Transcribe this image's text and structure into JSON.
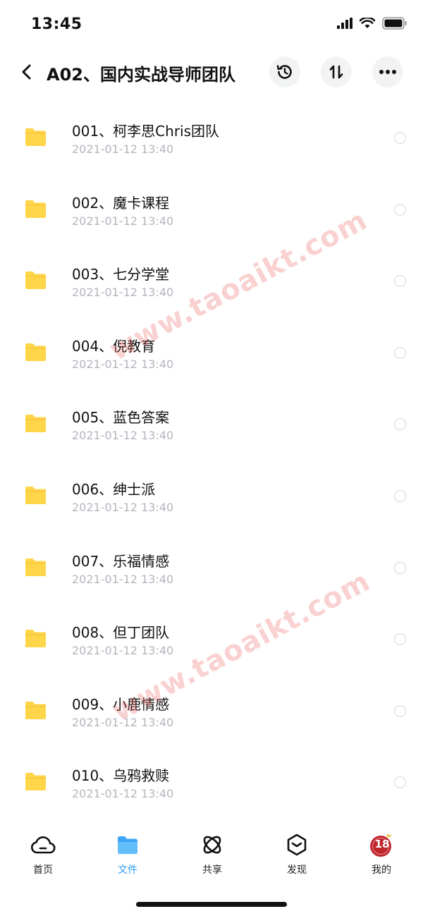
{
  "status_bar": {
    "time": "13:45"
  },
  "nav": {
    "title": "A02、国内实战导师团队",
    "icons": [
      "back-icon",
      "history-icon",
      "sort-icon",
      "more-icon"
    ]
  },
  "files": [
    {
      "name": "001、柯李思Chris团队",
      "date": "2021-01-12 13:40"
    },
    {
      "name": "002、魔卡课程",
      "date": "2021-01-12 13:40"
    },
    {
      "name": "003、七分学堂",
      "date": "2021-01-12 13:40"
    },
    {
      "name": "004、倪教育",
      "date": "2021-01-12 13:40"
    },
    {
      "name": "005、蓝色答案",
      "date": "2021-01-12 13:40"
    },
    {
      "name": "006、绅士派",
      "date": "2021-01-12 13:40"
    },
    {
      "name": "007、乐福情感",
      "date": "2021-01-12 13:40"
    },
    {
      "name": "008、但丁团队",
      "date": "2021-01-12 13:40"
    },
    {
      "name": "009、小鹿情感",
      "date": "2021-01-12 13:40"
    },
    {
      "name": "010、乌鸦救赎",
      "date": "2021-01-12 13:40"
    }
  ],
  "watermark": {
    "text": "www.taoaikt.com"
  },
  "tabs": [
    {
      "label": "首页",
      "icon": "cloud-icon"
    },
    {
      "label": "文件",
      "icon": "folder-icon",
      "active": true
    },
    {
      "label": "共享",
      "icon": "atom-icon"
    },
    {
      "label": "发现",
      "icon": "discover-icon"
    },
    {
      "label": "我的",
      "icon": "avatar-icon",
      "badge": "18"
    }
  ],
  "colors": {
    "folder": "#ffd54a",
    "active_tab": "#2f9bf3",
    "date_text": "#b3b6bd",
    "watermark": "#ec5a5a"
  }
}
